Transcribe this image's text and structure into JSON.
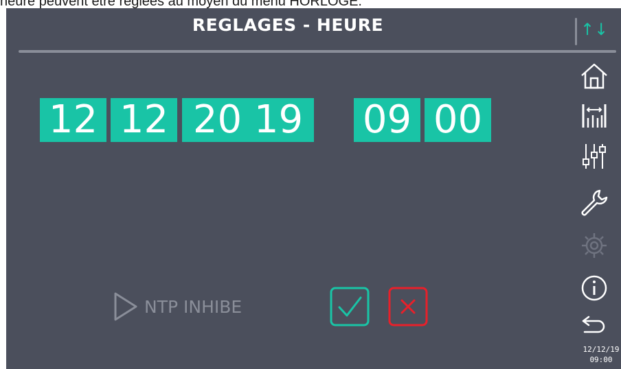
{
  "doc_text": "heure peuvent être réglées au moyen du menu HORLOGE.",
  "header": {
    "title": "REGLAGES - HEURE",
    "sort_glyph": "↑↓"
  },
  "datetime": {
    "day": "12",
    "month": "12",
    "year": "20 19",
    "hour": "09",
    "minute": "00"
  },
  "ntp": {
    "label": "NTP INHIBE"
  },
  "sidebar": {
    "icons": [
      "home-icon",
      "measure-icon",
      "sliders-icon",
      "wrench-icon",
      "gear-icon",
      "info-icon",
      "back-icon"
    ]
  },
  "status_clock": {
    "date": "12/12/19",
    "time": "09:00"
  },
  "colors": {
    "background": "#4b4f5c",
    "accent": "#19c4a6",
    "confirm": "#19c4a6",
    "cancel": "#e8202a",
    "muted": "#8a8e99"
  }
}
